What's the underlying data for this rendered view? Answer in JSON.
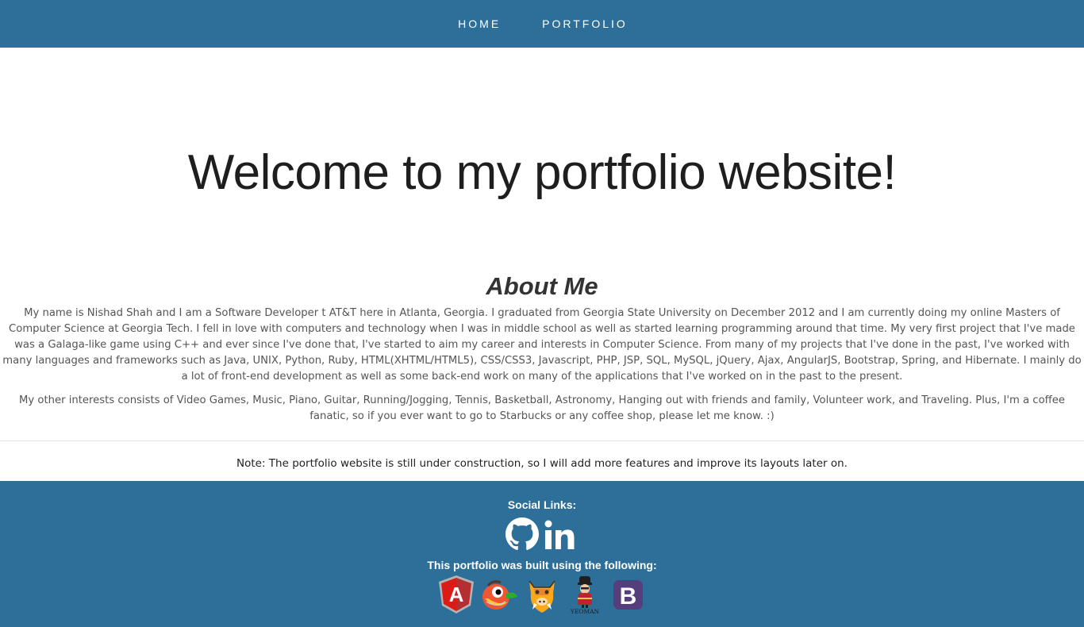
{
  "nav": {
    "links": [
      {
        "label": "HOME"
      },
      {
        "label": "PORTFOLIO"
      }
    ]
  },
  "hero": {
    "title": "Welcome to my portfolio website!"
  },
  "about": {
    "title": "About Me",
    "paragraph1": "My name is Nishad Shah and I am a Software Developer t AT&T here in Atlanta, Georgia. I graduated from Georgia State University on December 2012 and I am currently doing my online Masters of Computer Science at Georgia Tech. I fell in love with computers and technology when I was in middle school as well as started learning programming around that time. My very first project that I've made was a Galaga-like game using C++ and ever since I've done that, I've started to aim my career and interests in Computer Science. From many of my projects that I've done in the past, I've worked with many languages and frameworks such as Java, UNIX, Python, Ruby, HTML(XHTML/HTML5), CSS/CSS3, Javascript, PHP, JSP, SQL, MySQL, jQuery, Ajax, AngularJS, Bootstrap, Spring, and Hibernate. I mainly do a lot of front-end development as well as some back-end work on many of the applications that I've worked on in the past to the present.",
    "paragraph2": "My other interests consists of Video Games, Music, Piano, Guitar, Running/Jogging, Tennis, Basketball, Astronomy, Hanging out with friends and family, Volunteer work, and Traveling. Plus, I'm a coffee fanatic, so if you ever want to go to Starbucks or any coffee shop, please let me know. :)"
  },
  "note": {
    "text": "Note: The portfolio website is still under construction, so I will add more features and improve its layouts later on."
  },
  "footer": {
    "social_title": "Social Links:",
    "social_icons": [
      "github-icon",
      "linkedin-icon"
    ],
    "built_title": "This portfolio was built using the following:",
    "tech_icons": [
      "angularjs-icon",
      "bower-icon",
      "grunt-icon",
      "yeoman-icon",
      "bootstrap-icon"
    ],
    "yeoman_label": "YEOMAN",
    "bootstrap_letter": "B",
    "angular_letter": "A"
  },
  "colors": {
    "navbar_bg": "#2e6f99",
    "footer_bg": "#2e6f99",
    "bootstrap_purple": "#563d7c",
    "angular_red": "#dd1b16"
  }
}
